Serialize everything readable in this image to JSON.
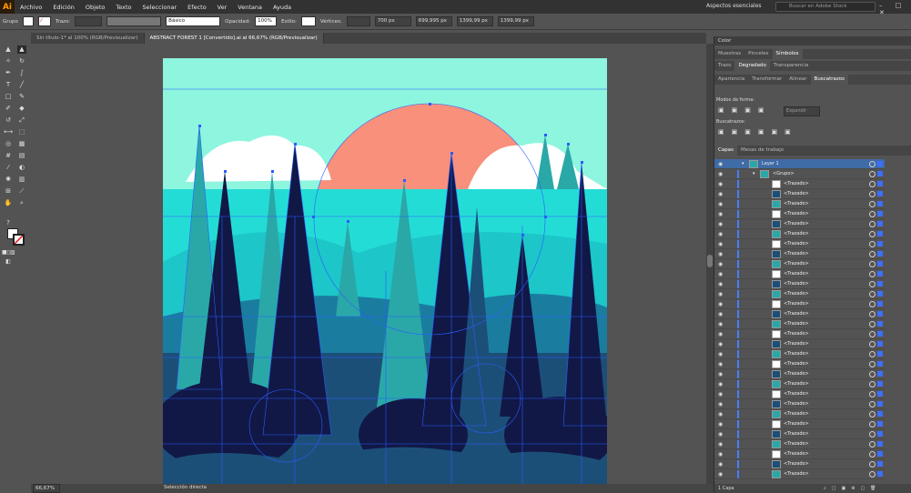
{
  "app": {
    "logo": "Ai",
    "menu": [
      "Archivo",
      "Edición",
      "Objeto",
      "Texto",
      "Seleccionar",
      "Efecto",
      "Ver",
      "Ventana",
      "Ayuda"
    ],
    "workspace": "Aspectos esenciales",
    "stock_placeholder": "Buscar en Adobe Stock",
    "window_buttons": "– □ ✕"
  },
  "control": {
    "selection": "Grupo",
    "stroke_label": "Trazo:",
    "brush": "Básico",
    "opacity_label": "Opacidad:",
    "opacity": "100%",
    "style_label": "Estilo:",
    "vertices_label": "Vértices:",
    "x": "700 px",
    "y": "699,995 px",
    "w": "1399,99 px",
    "h": "1399,99 px"
  },
  "tabs": [
    {
      "label": "Sin título-1* al 100% (RGB/Previsualizar)"
    },
    {
      "label": "ABSTRACT FOREST 1 [Convertido].ai al 66,67% (RGB/Previsualizar)"
    }
  ],
  "status": {
    "zoom": "66,67%",
    "tool": "Selección directa"
  },
  "color_panel": {
    "title": "Color",
    "tabs": [
      "Muestras",
      "Pinceles",
      "Símbolos"
    ],
    "tabs2": [
      "Trazo",
      "Degradado",
      "Transparencia"
    ]
  },
  "pathfinder": {
    "tabs": [
      "Apariencia",
      "Transformar",
      "Alinear",
      "Buscatrazos"
    ],
    "modes_label": "Modos de forma:",
    "expand": "Expandir",
    "pathfinders_label": "Buscatrazos:"
  },
  "layers": {
    "tabs": [
      "Capas",
      "Mesas de trabajo"
    ],
    "layer_name": "Layer 1",
    "group_name": "<Grupo>",
    "path_name": "<Trazado>",
    "footer": "1 Capa"
  },
  "colors": {
    "sky": "#8ef5de",
    "sun": "#f8907c",
    "cloud": "#ffffff",
    "hill": "#24dcd6",
    "dark": "#111846",
    "mid": "#1c4f78",
    "teal": "#2aa8a8",
    "selection": "#2b5cff"
  }
}
